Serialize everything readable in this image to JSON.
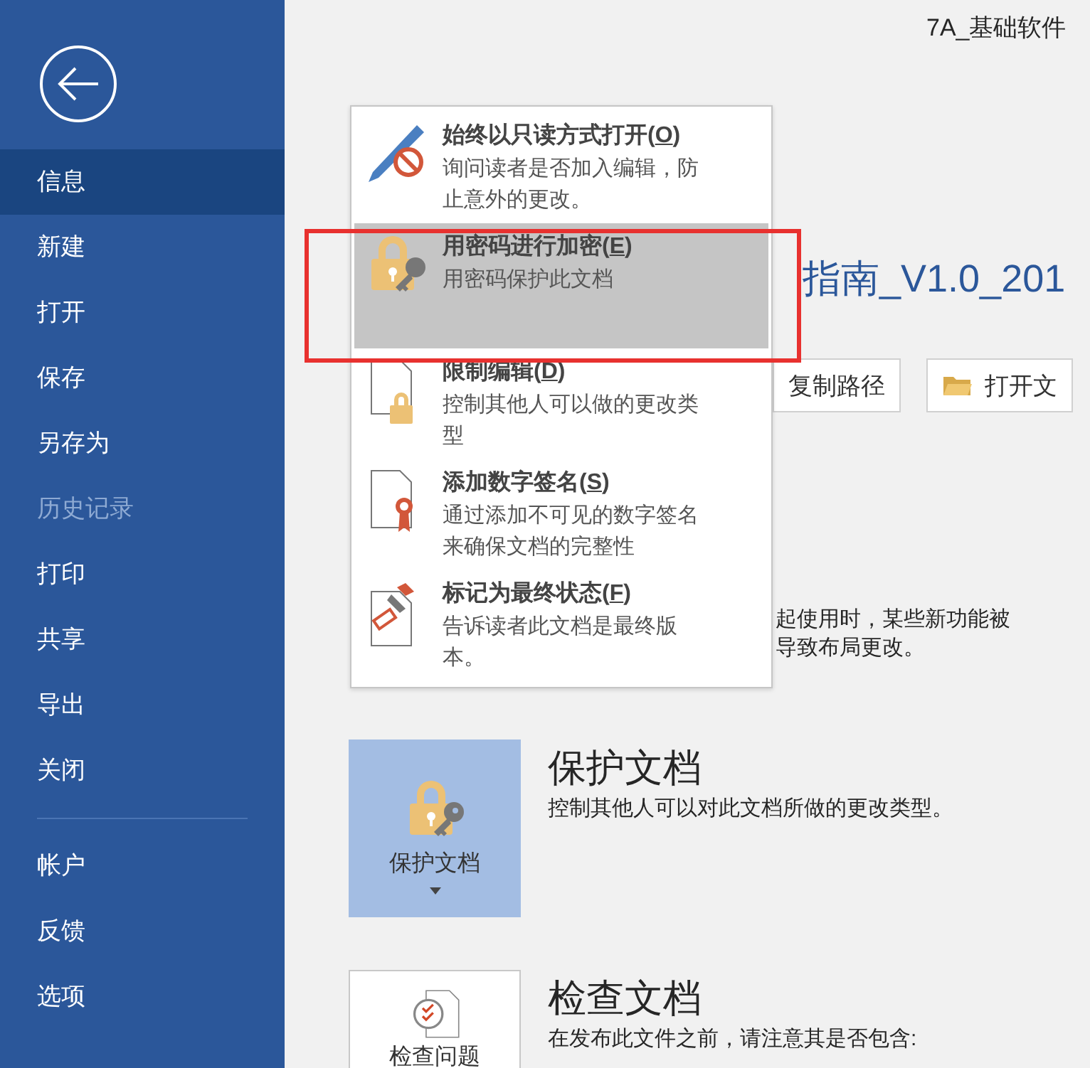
{
  "sidebar": {
    "items": [
      {
        "label": "信息",
        "selected": true,
        "disabled": false
      },
      {
        "label": "新建",
        "selected": false,
        "disabled": false
      },
      {
        "label": "打开",
        "selected": false,
        "disabled": false
      },
      {
        "label": "保存",
        "selected": false,
        "disabled": false
      },
      {
        "label": "另存为",
        "selected": false,
        "disabled": false
      },
      {
        "label": "历史记录",
        "selected": false,
        "disabled": true
      },
      {
        "label": "打印",
        "selected": false,
        "disabled": false
      },
      {
        "label": "共享",
        "selected": false,
        "disabled": false
      },
      {
        "label": "导出",
        "selected": false,
        "disabled": false
      },
      {
        "label": "关闭",
        "selected": false,
        "disabled": false
      }
    ],
    "bottom_items": [
      {
        "label": "帐户",
        "selected": false,
        "disabled": false
      },
      {
        "label": "反馈",
        "selected": false,
        "disabled": false
      },
      {
        "label": "选项",
        "selected": false,
        "disabled": false
      }
    ]
  },
  "document": {
    "title": "7A_基础软件",
    "heading": "指南_V1.0_201",
    "buttons": [
      {
        "kind": "plain",
        "label": "复制路径"
      },
      {
        "kind": "folder",
        "label": "打开文"
      }
    ],
    "notice_lines": [
      "起使用时，某些新功能被",
      "导致布局更改。"
    ]
  },
  "protect_menu": {
    "items": [
      {
        "kind": "read-only",
        "title": "始终以只读方式打开(O)",
        "description": "询问读者是否加入编辑，防止意外的更改。",
        "selected": false,
        "annotated": false
      },
      {
        "kind": "password",
        "title": "用密码进行加密(E)",
        "description": "用密码保护此文档",
        "selected": true,
        "annotated": true
      },
      {
        "kind": "restrict",
        "title": "限制编辑(D)",
        "description": "控制其他人可以做的更改类型",
        "selected": false,
        "annotated": false
      },
      {
        "kind": "signature",
        "title": "添加数字签名(S)",
        "description": "通过添加不可见的数字签名来确保文档的完整性",
        "selected": false,
        "annotated": false
      },
      {
        "kind": "final",
        "title": "标记为最终状态(F)",
        "description": "告诉读者此文档是最终版本。",
        "selected": false,
        "annotated": false
      }
    ]
  },
  "sections": [
    {
      "kind": "protect",
      "button_label": "保护文档",
      "selected": true,
      "heading": "保护文档",
      "description": "控制其他人可以对此文档所做的更改类型。"
    },
    {
      "kind": "inspect",
      "button_label": "检查问题",
      "selected": false,
      "heading": "检查文档",
      "description": "在发布此文件之前，请注意其是否包含:"
    }
  ]
}
